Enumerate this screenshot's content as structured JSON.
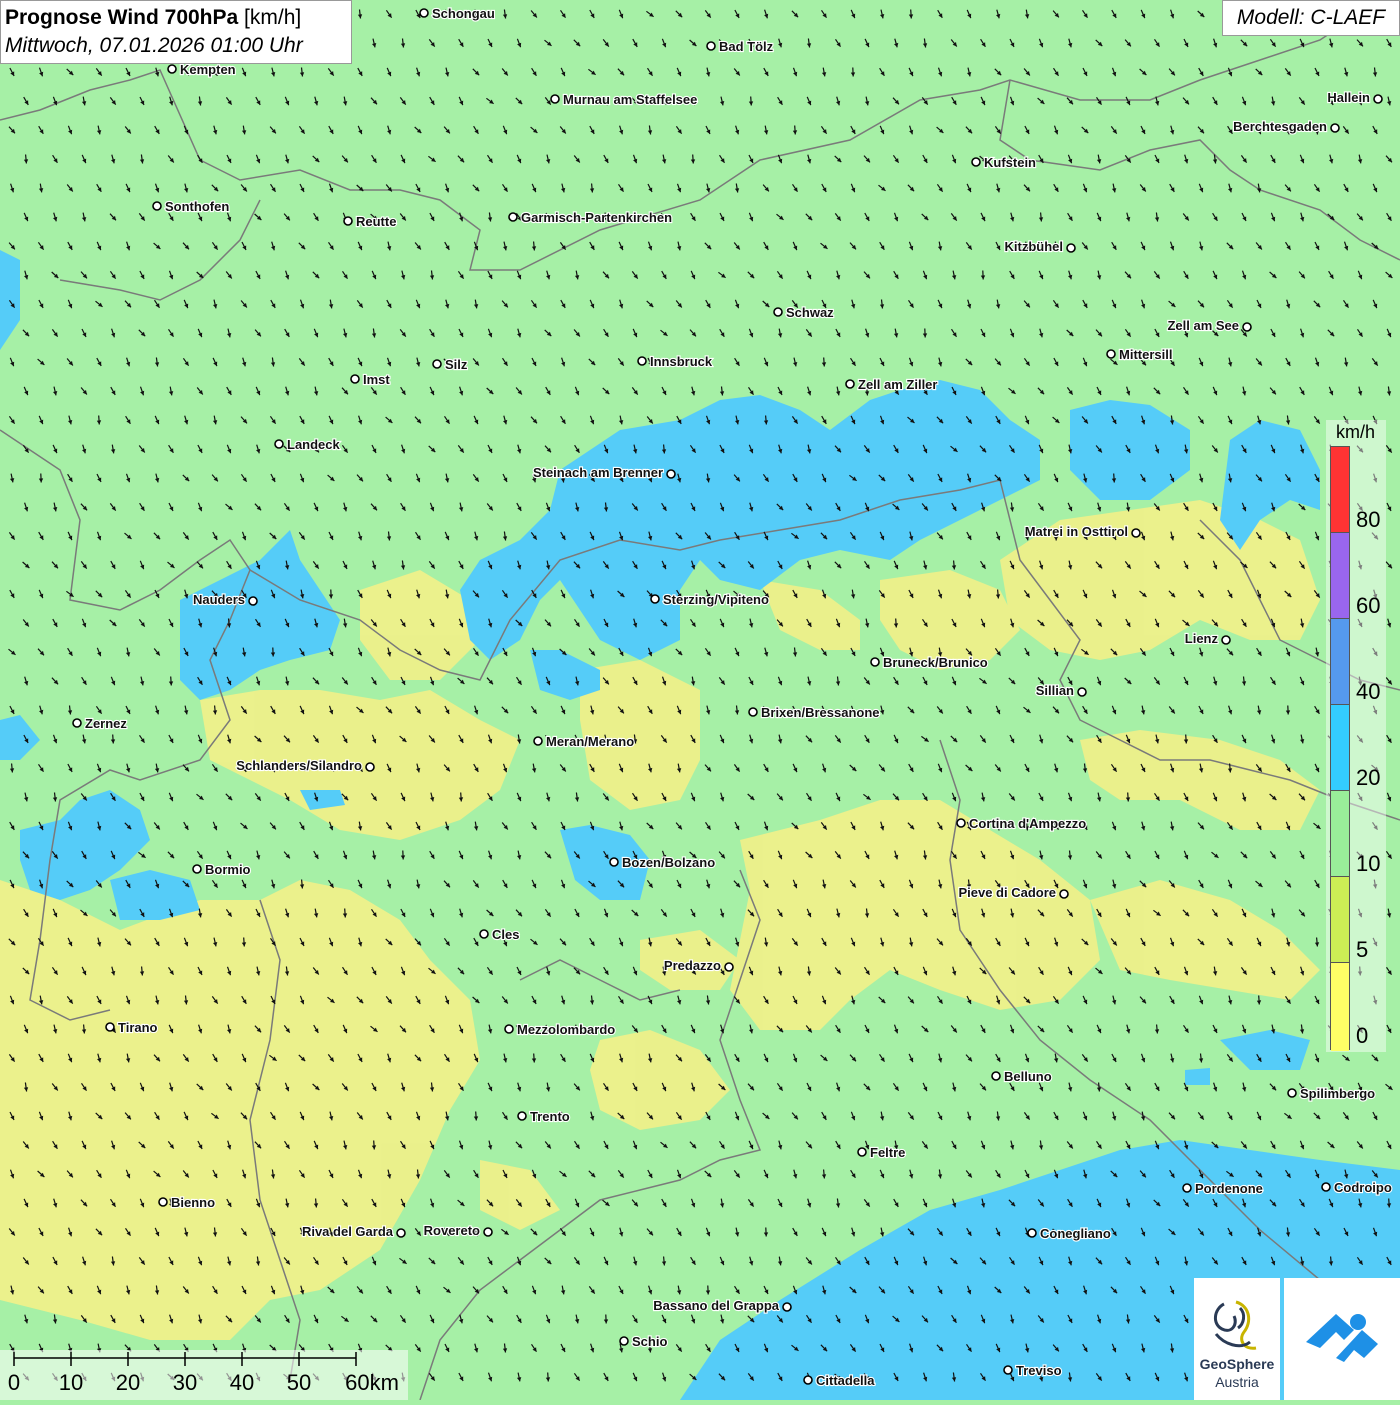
{
  "title": {
    "main": "Prognose Wind 700hPa",
    "unit": "[km/h]",
    "datetime": "Mittwoch, 07.01.2026 01:00 Uhr"
  },
  "model": "Modell: C-LAEF",
  "legend": {
    "unit": "km/h",
    "labels": [
      "80",
      "60",
      "40",
      "20",
      "10",
      "5",
      "0"
    ],
    "colors": [
      "#ff3333",
      "#9966ee",
      "#5599ee",
      "#33ccff",
      "#99ee99",
      "#ccee55",
      "#ffff66"
    ]
  },
  "scalebar": {
    "labels": [
      "0",
      "10",
      "20",
      "30",
      "40",
      "50",
      "60km"
    ]
  },
  "logo": {
    "line1": "GeoSphere",
    "line2": "Austria"
  },
  "colors": {
    "calm": "#ffff77",
    "light": "#a6f0a6",
    "moderate": "#55ccf8",
    "border": "#777777"
  },
  "cities": [
    {
      "name": "Schongau"
    },
    {
      "name": "Bad Tölz"
    },
    {
      "name": "Kempten"
    },
    {
      "name": "Murnau am Staffelsee"
    },
    {
      "name": "Hallein"
    },
    {
      "name": "Berchtesgaden"
    },
    {
      "name": "Kufstein"
    },
    {
      "name": "Sonthofen"
    },
    {
      "name": "Reutte"
    },
    {
      "name": "Garmisch-Partenkirchen"
    },
    {
      "name": "Kitzbühel"
    },
    {
      "name": "Schwaz"
    },
    {
      "name": "Zell am See"
    },
    {
      "name": "Mittersill"
    },
    {
      "name": "Innsbruck"
    },
    {
      "name": "Silz"
    },
    {
      "name": "Imst"
    },
    {
      "name": "Zell am Ziller"
    },
    {
      "name": "Landeck"
    },
    {
      "name": "Steinach am Brenner"
    },
    {
      "name": "Matrei in Osttirol"
    },
    {
      "name": "Nauders"
    },
    {
      "name": "Sterzing/Vipiteno"
    },
    {
      "name": "Lienz"
    },
    {
      "name": "Bruneck/Brunico"
    },
    {
      "name": "Sillian"
    },
    {
      "name": "Zernez"
    },
    {
      "name": "Brixen/Bressanone"
    },
    {
      "name": "Meran/Merano"
    },
    {
      "name": "Schlanders/Silandro"
    },
    {
      "name": "Cortina d'Ampezzo"
    },
    {
      "name": "Bozen/Bolzano"
    },
    {
      "name": "Bormio"
    },
    {
      "name": "Pieve di Cadore"
    },
    {
      "name": "Cles"
    },
    {
      "name": "Predazzo"
    },
    {
      "name": "Tirano"
    },
    {
      "name": "Mezzolombardo"
    },
    {
      "name": "Belluno"
    },
    {
      "name": "Spilimbergo"
    },
    {
      "name": "Trento"
    },
    {
      "name": "Feltre"
    },
    {
      "name": "Pordenone"
    },
    {
      "name": "Codroipo"
    },
    {
      "name": "Bienno"
    },
    {
      "name": "Riva del Garda"
    },
    {
      "name": "Rovereto"
    },
    {
      "name": "Conegliano"
    },
    {
      "name": "Bassano del Grappa"
    },
    {
      "name": "Schio"
    },
    {
      "name": "Treviso"
    },
    {
      "name": "Cittadella"
    }
  ]
}
